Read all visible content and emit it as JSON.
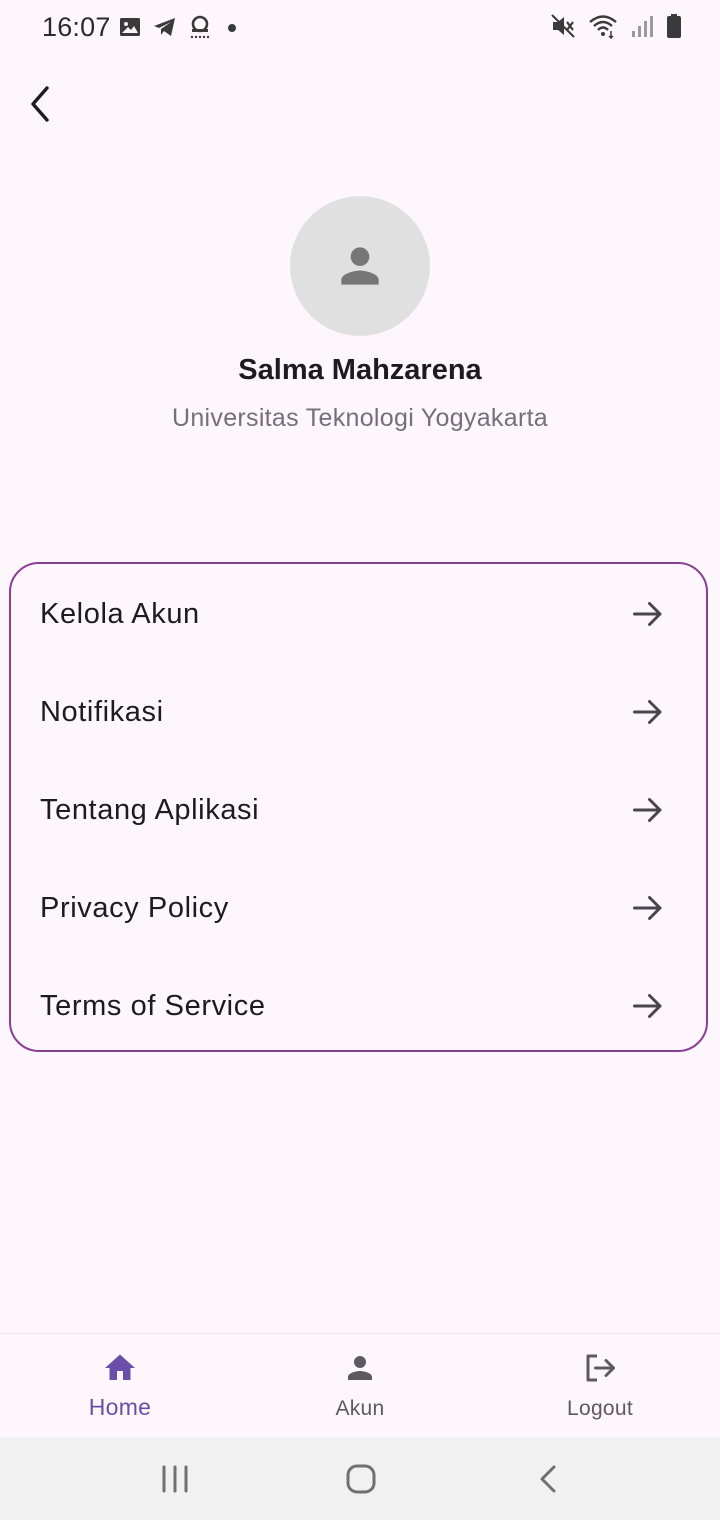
{
  "status_bar": {
    "time": "16:07",
    "left_icons": [
      "image-icon",
      "telegram-icon",
      "podcast-icon",
      "dot-icon"
    ],
    "right_icons": [
      "mute-icon",
      "wifi-icon",
      "signal-icon",
      "battery-icon"
    ]
  },
  "header": {
    "back_icon": "back-arrow-icon"
  },
  "profile": {
    "name": "Salma Mahzarena",
    "organization": "Universitas Teknologi Yogyakarta",
    "avatar_icon": "person-icon"
  },
  "menu": {
    "items": [
      {
        "label": "Kelola Akun",
        "icon": "arrow-right-icon"
      },
      {
        "label": "Notifikasi",
        "icon": "arrow-right-icon"
      },
      {
        "label": "Tentang Aplikasi",
        "icon": "arrow-right-icon"
      },
      {
        "label": "Privacy Policy",
        "icon": "arrow-right-icon"
      },
      {
        "label": "Terms of Service",
        "icon": "arrow-right-icon"
      }
    ]
  },
  "bottom_nav": {
    "items": [
      {
        "label": "Home",
        "icon": "home-icon",
        "active": true
      },
      {
        "label": "Akun",
        "icon": "person-icon",
        "active": false
      },
      {
        "label": "Logout",
        "icon": "logout-icon",
        "active": false
      }
    ]
  },
  "system_nav": {
    "icons": [
      "recent-apps-icon",
      "home-circle-icon",
      "system-back-icon"
    ]
  },
  "colors": {
    "background": "#fdf7fd",
    "card_border": "#8a3f93",
    "nav_active": "#6a4ea8",
    "avatar_bg": "#e0e0e0",
    "secondary_text": "#74707a"
  }
}
